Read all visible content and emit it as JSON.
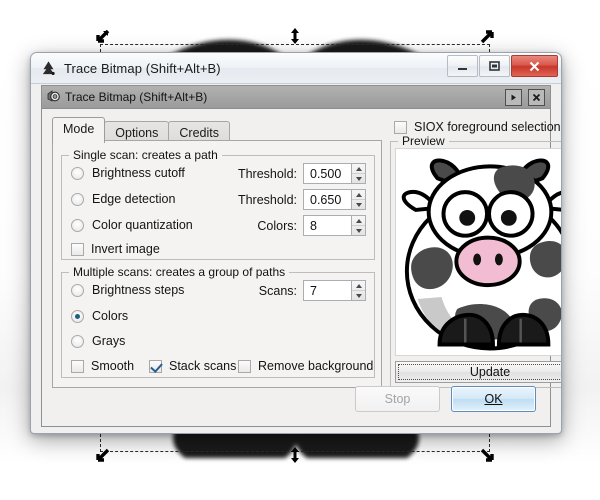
{
  "window": {
    "title": "Trace Bitmap (Shift+Alt+B)",
    "app_icon": "inkscape-logo-icon",
    "minimize_label": "–",
    "maximize_label": "□",
    "close_label": "✕"
  },
  "inner_window": {
    "title": "Trace Bitmap (Shift+Alt+B)",
    "icon": "dialog-stack-icon",
    "shade_label": "▶",
    "close_label": "✕"
  },
  "tabs": [
    {
      "label": "Mode",
      "active": true
    },
    {
      "label": "Options",
      "active": false
    },
    {
      "label": "Credits",
      "active": false
    }
  ],
  "single_scan": {
    "legend": "Single scan: creates a path",
    "options": [
      {
        "label": "Brightness cutoff",
        "selected": false,
        "field_label": "Threshold:",
        "value": "0.500"
      },
      {
        "label": "Edge detection",
        "selected": false,
        "field_label": "Threshold:",
        "value": "0.650"
      },
      {
        "label": "Color quantization",
        "selected": false,
        "field_label": "Colors:",
        "value": "8"
      }
    ],
    "invert": {
      "label": "Invert image",
      "checked": false
    }
  },
  "multiple_scans": {
    "legend": "Multiple scans: creates a group of paths",
    "options": [
      {
        "label": "Brightness steps",
        "selected": false
      },
      {
        "label": "Colors",
        "selected": true
      },
      {
        "label": "Grays",
        "selected": false
      }
    ],
    "scans": {
      "label": "Scans:",
      "value": "7"
    },
    "checks": [
      {
        "label": "Smooth",
        "checked": false
      },
      {
        "label": "Stack scans",
        "checked": true
      },
      {
        "label": "Remove background",
        "checked": false
      }
    ]
  },
  "siox": {
    "label": "SIOX foreground selection",
    "checked": false
  },
  "preview": {
    "legend": "Preview",
    "image_alt": "cartoon-cow-preview",
    "update_label": "Update"
  },
  "actions": {
    "stop_label": "Stop",
    "stop_disabled": true,
    "ok_label": "OK",
    "ok_accesskey": "O"
  },
  "colors": {
    "accent_radio": "#1f6080",
    "check_mark": "#2a5d8f",
    "close_button": "#c8372a",
    "default_button_border": "#5a8fbd",
    "cow_spot": "#4a4a4a",
    "cow_nose": "#f2bdd2",
    "cow_shade": "#c9c9c9"
  },
  "canvas": {
    "selection_handles": [
      "top-left",
      "top-center",
      "top-right",
      "bottom-left",
      "bottom-center",
      "bottom-right"
    ]
  }
}
